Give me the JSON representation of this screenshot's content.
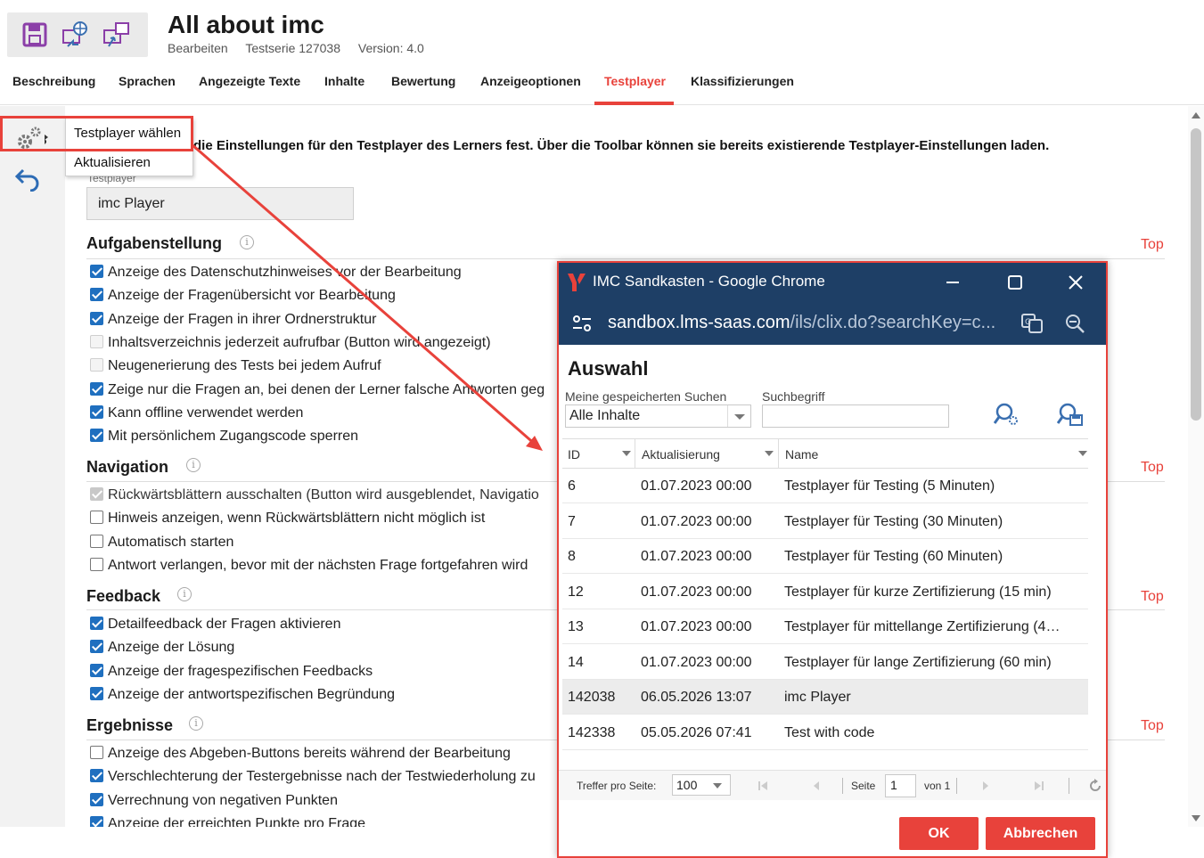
{
  "header": {
    "title": "All about imc",
    "subtitle": [
      "Bearbeiten",
      "Testserie 127038",
      "Version: 4.0"
    ]
  },
  "tabs": [
    "Beschreibung",
    "Sprachen",
    "Angezeigte Texte",
    "Inhalte",
    "Bewertung",
    "Anzeigeoptionen",
    "Testplayer",
    "Klassifizierungen"
  ],
  "active_tab": "Testplayer",
  "context_menu": {
    "items": [
      "Testplayer wählen",
      "Aktualisieren"
    ]
  },
  "intro_text": "die Einstellungen für den Testplayer des Lerners fest. Über die Toolbar können sie bereits existierende Testplayer-Einstellungen laden.",
  "testplayer_field": {
    "label": "Testplayer",
    "value": "imc Player"
  },
  "top_link": "Top",
  "sections": {
    "aufgabenstellung": {
      "title": "Aufgabenstellung",
      "items": [
        {
          "label": "Anzeige des Datenschutzhinweises vor der Bearbeitung",
          "checked": true
        },
        {
          "label": "Anzeige der Fragenübersicht vor Bearbeitung",
          "checked": true
        },
        {
          "label": "Anzeige der Fragen in ihrer Ordnerstruktur",
          "checked": true
        },
        {
          "label": "Inhaltsverzeichnis jederzeit aufrufbar (Button wird angezeigt)",
          "checked": false
        },
        {
          "label": "Neugenerierung des Tests bei jedem Aufruf",
          "checked": false
        },
        {
          "label": "Zeige nur die Fragen an, bei denen der Lerner falsche Antworten geg",
          "checked": true
        },
        {
          "label": "Kann offline verwendet werden",
          "checked": true
        },
        {
          "label": "Mit persönlichem Zugangscode sperren",
          "checked": true
        }
      ]
    },
    "navigation": {
      "title": "Navigation",
      "items": [
        {
          "label": "Rückwärtsblättern ausschalten (Button wird ausgeblendet, Navigatio",
          "checked": true
        },
        {
          "label": "Hinweis anzeigen, wenn Rückwärtsblättern nicht möglich ist",
          "checked": false
        },
        {
          "label": "Automatisch starten",
          "checked": false
        },
        {
          "label": "Antwort verlangen, bevor mit der nächsten Frage fortgefahren wird",
          "checked": false
        }
      ]
    },
    "feedback": {
      "title": "Feedback",
      "items": [
        {
          "label": "Detailfeedback der Fragen aktivieren",
          "checked": true
        },
        {
          "label": "Anzeige der Lösung",
          "checked": true
        },
        {
          "label": "Anzeige der fragespezifischen Feedbacks",
          "checked": true
        },
        {
          "label": "Anzeige der antwortspezifischen Begründung",
          "checked": true
        }
      ]
    },
    "ergebnisse": {
      "title": "Ergebnisse",
      "items": [
        {
          "label": "Anzeige des Abgeben-Buttons bereits während der Bearbeitung",
          "checked": false
        },
        {
          "label": "Verschlechterung der Testergebnisse nach der Testwiederholung zu",
          "checked": true
        },
        {
          "label": "Verrechnung von negativen Punkten",
          "checked": true
        },
        {
          "label": "Anzeige der erreichten Punkte pro Frage",
          "checked": true
        }
      ]
    }
  },
  "popup": {
    "window_title": "IMC Sandkasten - Google Chrome",
    "url_host": "sandbox.lms-saas.com",
    "url_path": "/ils/clix.do?searchKey=c...",
    "heading": "Auswahl",
    "saved_search_label": "Meine gespeicherten Suchen",
    "saved_search_value": "Alle Inhalte",
    "search_term_label": "Suchbegriff",
    "search_term_value": "",
    "columns": [
      "ID",
      "Aktualisierung",
      "Name"
    ],
    "rows": [
      {
        "id": "6",
        "updated": "01.07.2023 00:00",
        "name": "Testplayer für Testing (5 Minuten)"
      },
      {
        "id": "7",
        "updated": "01.07.2023 00:00",
        "name": "Testplayer für Testing (30 Minuten)"
      },
      {
        "id": "8",
        "updated": "01.07.2023 00:00",
        "name": "Testplayer für Testing (60 Minuten)"
      },
      {
        "id": "12",
        "updated": "01.07.2023 00:00",
        "name": "Testplayer für kurze Zertifizierung (15 min)"
      },
      {
        "id": "13",
        "updated": "01.07.2023 00:00",
        "name": "Testplayer für mittellange Zertifizierung (4…"
      },
      {
        "id": "14",
        "updated": "01.07.2023 00:00",
        "name": "Testplayer für lange Zertifizierung (60 min)"
      },
      {
        "id": "142038",
        "updated": "06.05.2026 13:07",
        "name": "imc Player"
      },
      {
        "id": "142338",
        "updated": "05.05.2026 07:41",
        "name": "Test with code"
      }
    ],
    "selected_row_index": 6,
    "paging": {
      "per_page_label": "Treffer pro Seite:",
      "per_page_value": "100",
      "page_label": "Seite",
      "page_value": "1",
      "of_label": "von 1"
    },
    "ok_label": "OK",
    "cancel_label": "Abbrechen"
  },
  "colors": {
    "accent": "#e8423b",
    "chrome_bar": "#1e3f66",
    "checkbox": "#1f6fbf"
  }
}
